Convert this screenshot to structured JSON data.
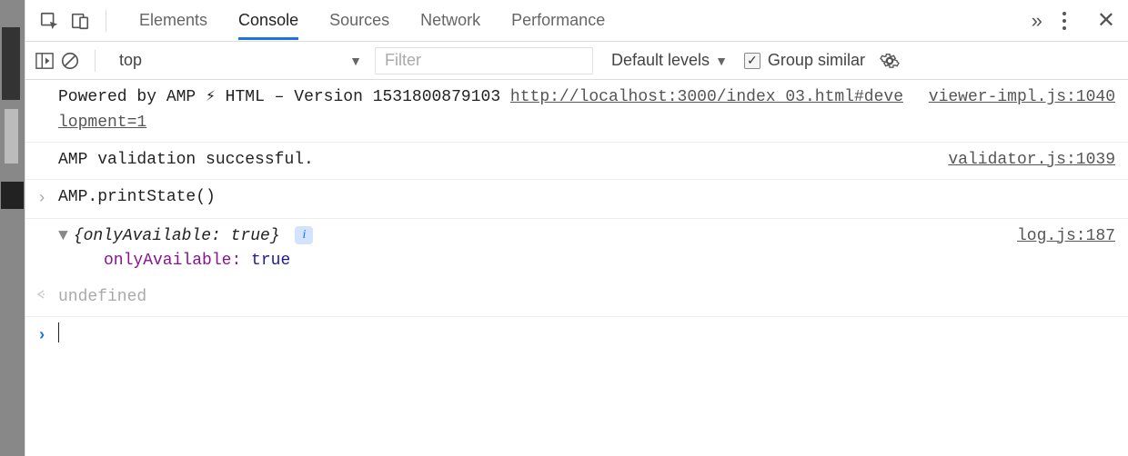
{
  "tabs": {
    "elements": "Elements",
    "console": "Console",
    "sources": "Sources",
    "network": "Network",
    "performance": "Performance"
  },
  "toolbar": {
    "context": "top",
    "filter_placeholder": "Filter",
    "levels": "Default levels",
    "group_similar": "Group similar"
  },
  "log": {
    "amp_banner_prefix": "Powered by AMP ⚡ HTML – Version 1531800879103 ",
    "amp_banner_url": "http://localhost:3000/index_03.html#development=1",
    "amp_banner_src": "viewer-impl.js:1040",
    "validation_msg": "AMP validation successful.",
    "validation_src": "validator.js:1039",
    "command": "AMP.printState()",
    "object_preview": "{onlyAvailable: true}",
    "object_key": "onlyAvailable",
    "object_value": "true",
    "object_src": "log.js:187",
    "return_value": "undefined"
  }
}
